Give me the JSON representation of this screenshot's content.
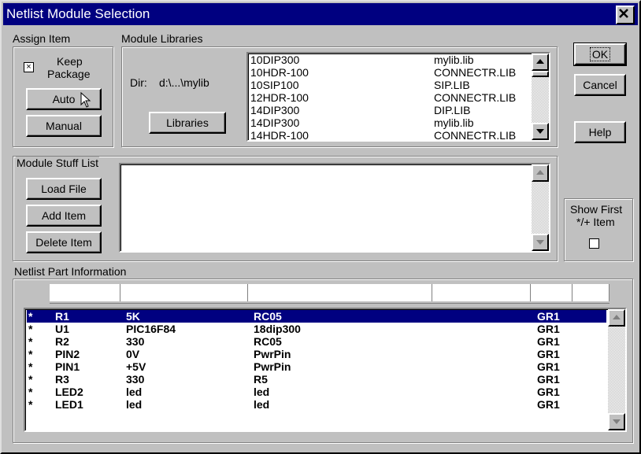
{
  "window": {
    "title": "Netlist Module Selection"
  },
  "assign": {
    "group_label": "Assign Item",
    "keep_label_1": "Keep",
    "keep_label_2": "Package",
    "keep_checked_mark": "×",
    "auto_label": "Auto",
    "manual_label": "Manual"
  },
  "libraries": {
    "group_label": "Module Libraries",
    "dir_label": "Dir:",
    "dir_value": "d:\\...\\mylib",
    "button_label": "Libraries",
    "items": [
      {
        "name": "10DIP300",
        "lib": "mylib.lib"
      },
      {
        "name": "10HDR-100",
        "lib": "CONNECTR.LIB"
      },
      {
        "name": "10SIP100",
        "lib": "SIP.LIB"
      },
      {
        "name": "12HDR-100",
        "lib": "CONNECTR.LIB"
      },
      {
        "name": "14DIP300",
        "lib": "DIP.LIB"
      },
      {
        "name": "14DIP300",
        "lib": "mylib.lib"
      },
      {
        "name": "14HDR-100",
        "lib": "CONNECTR.LIB"
      }
    ]
  },
  "buttons": {
    "ok": "OK",
    "cancel": "Cancel",
    "help": "Help"
  },
  "stuff": {
    "group_label": "Module Stuff List",
    "load_label": "Load File",
    "add_label": "Add Item",
    "delete_label": "Delete Item"
  },
  "show_first": {
    "line1": "Show First",
    "line2": "*/+ Item"
  },
  "parts": {
    "group_label": "Netlist Part Information",
    "rows": [
      {
        "mark": "*",
        "ref": "R1",
        "value": "5K",
        "module": "RC05",
        "group": "GR1",
        "selected": true
      },
      {
        "mark": "*",
        "ref": "U1",
        "value": "PIC16F84",
        "module": "18dip300",
        "group": "GR1"
      },
      {
        "mark": "*",
        "ref": "R2",
        "value": "330",
        "module": "RC05",
        "group": "GR1"
      },
      {
        "mark": "*",
        "ref": "PIN2",
        "value": "0V",
        "module": "PwrPin",
        "group": "GR1"
      },
      {
        "mark": "*",
        "ref": "PIN1",
        "value": "+5V",
        "module": "PwrPin",
        "group": "GR1"
      },
      {
        "mark": "*",
        "ref": "R3",
        "value": "330",
        "module": "R5",
        "group": "GR1"
      },
      {
        "mark": "*",
        "ref": "LED2",
        "value": "led",
        "module": "led",
        "group": "GR1"
      },
      {
        "mark": "*",
        "ref": "LED1",
        "value": "led",
        "module": "led",
        "group": "GR1"
      }
    ]
  },
  "icons": {
    "close": "close-icon",
    "cursor": "mouse-cursor-icon",
    "scroll_up": "scroll-up-arrow-icon",
    "scroll_down": "scroll-down-arrow-icon"
  }
}
